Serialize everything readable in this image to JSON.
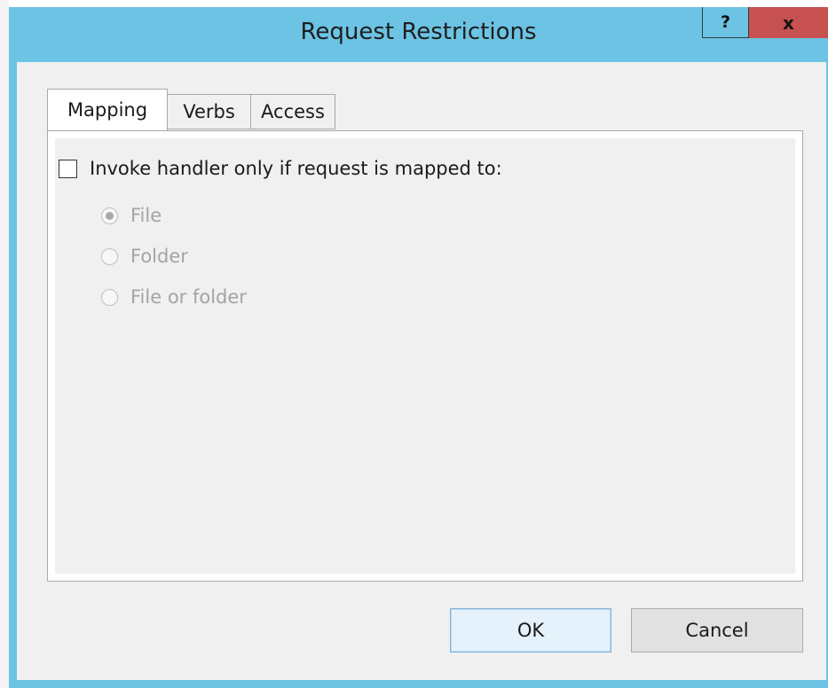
{
  "window": {
    "title": "Request Restrictions",
    "help_label": "?",
    "close_label": "x"
  },
  "tabs": [
    {
      "label": "Mapping",
      "active": true
    },
    {
      "label": "Verbs",
      "active": false
    },
    {
      "label": "Access",
      "active": false
    }
  ],
  "mapping": {
    "checkbox_label": "Invoke handler only if request is mapped to:",
    "checkbox_checked": false,
    "options": [
      {
        "label": "File",
        "selected": true,
        "enabled": false
      },
      {
        "label": "Folder",
        "selected": false,
        "enabled": false
      },
      {
        "label": "File or folder",
        "selected": false,
        "enabled": false
      }
    ]
  },
  "buttons": {
    "ok_label": "OK",
    "cancel_label": "Cancel"
  },
  "colors": {
    "title_bar": "#6cc3e3",
    "close_button": "#c75050",
    "dialog_background": "#f0f0f0"
  }
}
